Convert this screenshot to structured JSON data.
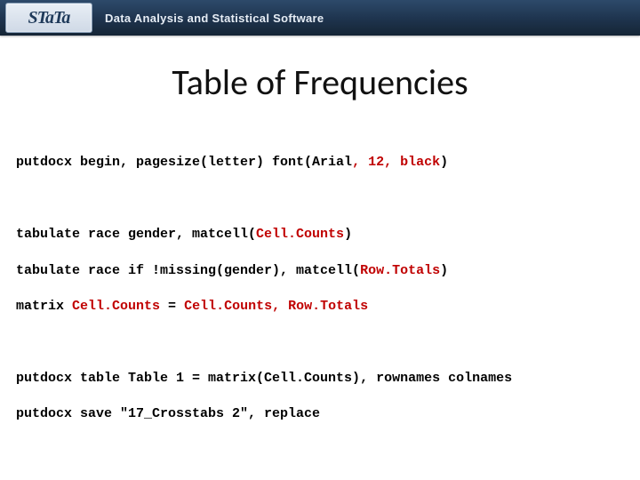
{
  "header": {
    "logo": "STaTa",
    "tagline": "Data Analysis and Statistical Software"
  },
  "title": "Table of Frequencies",
  "code": {
    "l1a": "putdocx begin, pagesize(letter) font(Arial",
    "l1b": ", 12, black",
    "l1c": ")",
    "l2a": "tabulate race gender, matcell(",
    "l2b": "Cell.Counts",
    "l2c": ")",
    "l3a": "tabulate race if !missing(gender), matcell(",
    "l3b": "Row.Totals",
    "l3c": ")",
    "l4a": "matrix ",
    "l4b": "Cell.Counts",
    "l4c": " = ",
    "l4d": "Cell.Counts",
    "l4e": ", Row.Totals",
    "l5": "putdocx table Table 1 = matrix(Cell.Counts), rownames colnames",
    "l6": "putdocx save \"17_Crosstabs 2\", replace"
  }
}
